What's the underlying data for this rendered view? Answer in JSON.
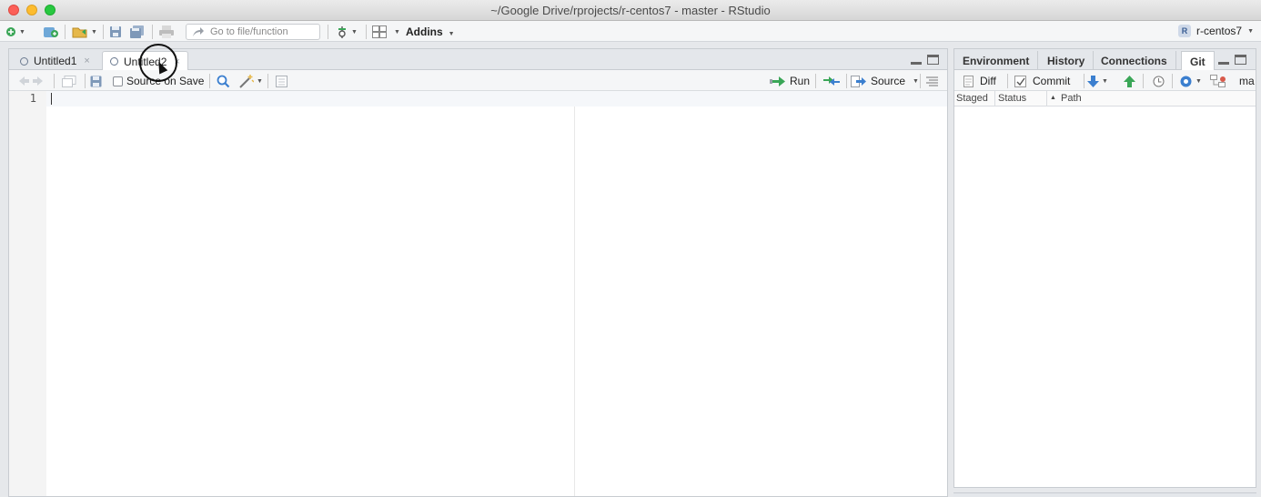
{
  "window": {
    "title": "~/Google Drive/rprojects/r-centos7 - master - RStudio"
  },
  "main_toolbar": {
    "goto_placeholder": "Go to file/function",
    "addins_label": "Addins",
    "project_label": "r-centos7",
    "project_logo": "R"
  },
  "source_pane": {
    "tabs": [
      {
        "label": "Untitled1",
        "close": "×"
      },
      {
        "label": "Untitled2",
        "close": "×"
      }
    ],
    "toolbar": {
      "source_on_save": "Source on Save",
      "run_label": "Run",
      "source_label": "Source"
    },
    "editor": {
      "line_numbers": [
        "1"
      ]
    }
  },
  "right_pane": {
    "tabs": [
      {
        "label": "Environment"
      },
      {
        "label": "History"
      },
      {
        "label": "Connections"
      },
      {
        "label": "Git"
      }
    ],
    "toolbar": {
      "diff_label": "Diff",
      "commit_label": "Commit",
      "branch_label": "ma"
    },
    "git_columns": [
      "Staged",
      "Status",
      "Path"
    ]
  },
  "icons": {
    "new_file": "new-file-icon",
    "open": "open-folder-icon",
    "save": "save-icon",
    "save_all": "save-all-icon",
    "print": "print-icon",
    "search": "search-icon",
    "wand": "magic-wand-icon",
    "pull": "pull-arrow-icon",
    "push": "push-arrow-icon",
    "history": "clock-icon",
    "gear": "gear-icon"
  },
  "colors": {
    "accent_blue": "#3b7fcf",
    "green": "#3aa657"
  }
}
